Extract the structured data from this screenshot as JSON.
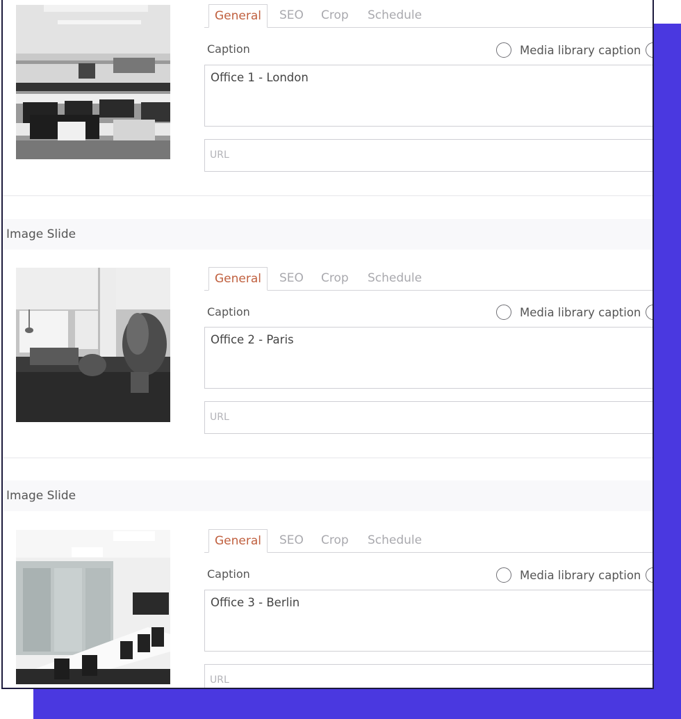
{
  "slides": [
    {
      "header": "",
      "image_alt": "Open-plan office with rows of desks and monitors",
      "tabs": [
        "General",
        "SEO",
        "Crop",
        "Schedule"
      ],
      "caption_label": "Caption",
      "media_option": "Media library caption",
      "caption_value": "Office 1 - London",
      "url_placeholder": "URL"
    },
    {
      "header": "Image Slide",
      "image_alt": "Bright loft office with plants and a central pillar",
      "tabs": [
        "General",
        "SEO",
        "Crop",
        "Schedule"
      ],
      "caption_label": "Caption",
      "media_option": "Media library caption",
      "caption_value": "Office 2 - Paris",
      "url_placeholder": "URL"
    },
    {
      "header": "Image Slide",
      "image_alt": "White meeting room with glass wall and long table",
      "tabs": [
        "General",
        "SEO",
        "Crop",
        "Schedule"
      ],
      "caption_label": "Caption",
      "media_option": "Media library caption",
      "caption_value": "Office 3 - Berlin",
      "url_placeholder": "URL"
    }
  ],
  "colors": {
    "accent_tab": "#c0603f",
    "backdrop": "#4a38e0",
    "frame_border": "#1c1a3c"
  }
}
